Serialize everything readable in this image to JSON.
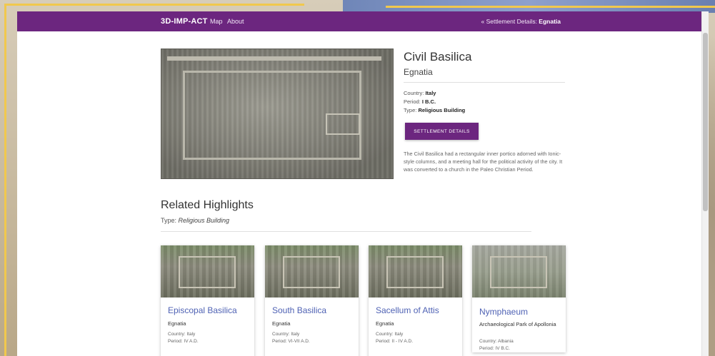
{
  "navbar": {
    "brand": "3D-IMP-ACT",
    "links": [
      "Map",
      "About"
    ],
    "crumb_prefix": "« Settlement Details: ",
    "crumb_name": "Egnatia"
  },
  "monument": {
    "title": "Civil Basilica",
    "settlement": "Egnatia",
    "country_label": "Country: ",
    "country": "Italy",
    "period_label": "Period: ",
    "period": "I B.C.",
    "type_label": "Type: ",
    "type": "Religious Building",
    "button": "SETTLEMENT DETAILS",
    "description": "The Civil Basilica had a rectangular inner portico adorned with Ionic-style columns, and a meeting hall for the political activity of the city. It was converted to a church in the Paleo Christian Period."
  },
  "related": {
    "title": "Related Highlights",
    "type_label": "Type: ",
    "type": "Religious Building",
    "cards": [
      {
        "title": "Episcopal Basilica",
        "settlement": "Egnatia",
        "country": "Country: Italy",
        "period": "Period: IV A.D."
      },
      {
        "title": "South Basilica",
        "settlement": "Egnatia",
        "country": "Country: Italy",
        "period": "Period: VI-VII A.D."
      },
      {
        "title": "Sacellum of Attis",
        "settlement": "Egnatia",
        "country": "Country: Italy",
        "period": "Period: II - IV A.D."
      },
      {
        "title": "Nymphaeum",
        "settlement": "Archaeological Park of Apollonia",
        "country": "Country: Albania",
        "period": "Period: IV B.C."
      }
    ]
  },
  "colors": {
    "brand": "#6c267f",
    "card_title": "#4f62b4",
    "frame": "#f1c84d"
  }
}
